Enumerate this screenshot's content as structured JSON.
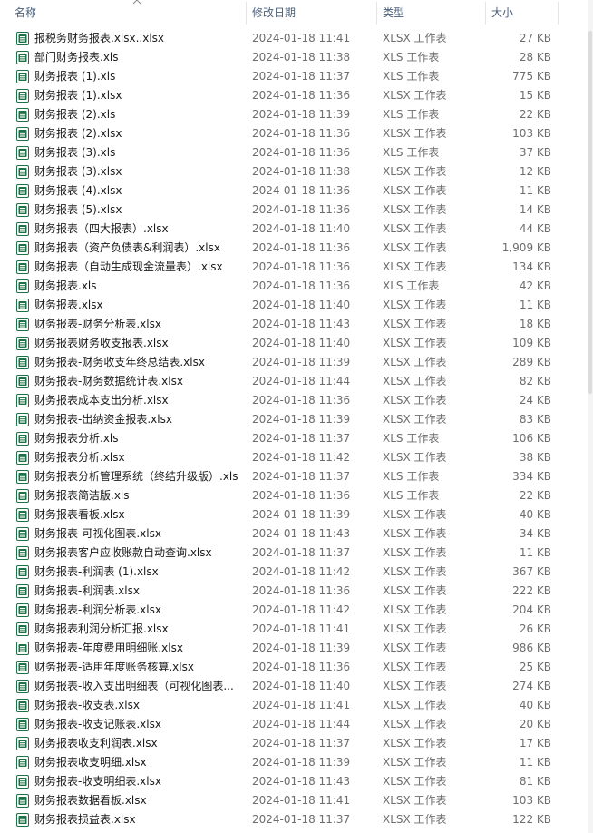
{
  "columns": {
    "name": "名称",
    "date": "修改日期",
    "type": "类型",
    "size": "大小"
  },
  "icons": {
    "sort": "sort-ascending-icon",
    "file": "excel-file-icon"
  },
  "colors": {
    "excel_green": "#1e7145",
    "header_text": "#4c607a",
    "meta_text": "#6d6d6d"
  },
  "files": [
    {
      "name": "报税务财务报表.xlsx..xlsx",
      "date": "2024-01-18 11:41",
      "type": "XLSX 工作表",
      "size": "27 KB"
    },
    {
      "name": "部门财务报表.xls",
      "date": "2024-01-18 11:38",
      "type": "XLS 工作表",
      "size": "28 KB"
    },
    {
      "name": "财务报表 (1).xls",
      "date": "2024-01-18 11:37",
      "type": "XLS 工作表",
      "size": "775 KB"
    },
    {
      "name": "财务报表 (1).xlsx",
      "date": "2024-01-18 11:36",
      "type": "XLSX 工作表",
      "size": "15 KB"
    },
    {
      "name": "财务报表 (2).xls",
      "date": "2024-01-18 11:39",
      "type": "XLS 工作表",
      "size": "22 KB"
    },
    {
      "name": "财务报表 (2).xlsx",
      "date": "2024-01-18 11:36",
      "type": "XLSX 工作表",
      "size": "103 KB"
    },
    {
      "name": "财务报表 (3).xls",
      "date": "2024-01-18 11:36",
      "type": "XLS 工作表",
      "size": "37 KB"
    },
    {
      "name": "财务报表 (3).xlsx",
      "date": "2024-01-18 11:38",
      "type": "XLSX 工作表",
      "size": "12 KB"
    },
    {
      "name": "财务报表 (4).xlsx",
      "date": "2024-01-18 11:36",
      "type": "XLSX 工作表",
      "size": "11 KB"
    },
    {
      "name": "财务报表 (5).xlsx",
      "date": "2024-01-18 11:36",
      "type": "XLSX 工作表",
      "size": "14 KB"
    },
    {
      "name": "财务报表（四大报表）.xlsx",
      "date": "2024-01-18 11:40",
      "type": "XLSX 工作表",
      "size": "44 KB"
    },
    {
      "name": "财务报表（资产负债表&利润表）.xlsx",
      "date": "2024-01-18 11:36",
      "type": "XLSX 工作表",
      "size": "1,909 KB"
    },
    {
      "name": "财务报表（自动生成现金流量表）.xlsx",
      "date": "2024-01-18 11:36",
      "type": "XLSX 工作表",
      "size": "134 KB"
    },
    {
      "name": "财务报表.xls",
      "date": "2024-01-18 11:36",
      "type": "XLS 工作表",
      "size": "42 KB"
    },
    {
      "name": "财务报表.xlsx",
      "date": "2024-01-18 11:40",
      "type": "XLSX 工作表",
      "size": "11 KB"
    },
    {
      "name": "财务报表-财务分析表.xlsx",
      "date": "2024-01-18 11:43",
      "type": "XLSX 工作表",
      "size": "18 KB"
    },
    {
      "name": "财务报表财务收支报表.xlsx",
      "date": "2024-01-18 11:40",
      "type": "XLSX 工作表",
      "size": "109 KB"
    },
    {
      "name": "财务报表-财务收支年终总结表.xlsx",
      "date": "2024-01-18 11:39",
      "type": "XLSX 工作表",
      "size": "289 KB"
    },
    {
      "name": "财务报表-财务数据统计表.xlsx",
      "date": "2024-01-18 11:44",
      "type": "XLSX 工作表",
      "size": "82 KB"
    },
    {
      "name": "财务报表成本支出分析.xlsx",
      "date": "2024-01-18 11:36",
      "type": "XLSX 工作表",
      "size": "24 KB"
    },
    {
      "name": "财务报表-出纳资金报表.xlsx",
      "date": "2024-01-18 11:39",
      "type": "XLSX 工作表",
      "size": "83 KB"
    },
    {
      "name": "财务报表分析.xls",
      "date": "2024-01-18 11:37",
      "type": "XLS 工作表",
      "size": "106 KB"
    },
    {
      "name": "财务报表分析.xlsx",
      "date": "2024-01-18 11:42",
      "type": "XLSX 工作表",
      "size": "38 KB"
    },
    {
      "name": "财务报表分析管理系统（终结升级版）.xls",
      "date": "2024-01-18 11:37",
      "type": "XLS 工作表",
      "size": "334 KB"
    },
    {
      "name": "财务报表简洁版.xls",
      "date": "2024-01-18 11:36",
      "type": "XLS 工作表",
      "size": "22 KB"
    },
    {
      "name": "财务报表看板.xlsx",
      "date": "2024-01-18 11:39",
      "type": "XLSX 工作表",
      "size": "40 KB"
    },
    {
      "name": "财务报表-可视化图表.xlsx",
      "date": "2024-01-18 11:43",
      "type": "XLSX 工作表",
      "size": "34 KB"
    },
    {
      "name": "财务报表客户应收账款自动查询.xlsx",
      "date": "2024-01-18 11:37",
      "type": "XLSX 工作表",
      "size": "11 KB"
    },
    {
      "name": "财务报表-利润表 (1).xlsx",
      "date": "2024-01-18 11:42",
      "type": "XLSX 工作表",
      "size": "367 KB"
    },
    {
      "name": "财务报表-利润表.xlsx",
      "date": "2024-01-18 11:36",
      "type": "XLSX 工作表",
      "size": "222 KB"
    },
    {
      "name": "财务报表-利润分析表.xlsx",
      "date": "2024-01-18 11:42",
      "type": "XLSX 工作表",
      "size": "204 KB"
    },
    {
      "name": "财务报表利润分析汇报.xlsx",
      "date": "2024-01-18 11:41",
      "type": "XLSX 工作表",
      "size": "26 KB"
    },
    {
      "name": "财务报表-年度费用明细账.xlsx",
      "date": "2024-01-18 11:39",
      "type": "XLSX 工作表",
      "size": "986 KB"
    },
    {
      "name": "财务报表-适用年度账务核算.xlsx",
      "date": "2024-01-18 11:36",
      "type": "XLSX 工作表",
      "size": "25 KB"
    },
    {
      "name": "财务报表-收入支出明细表（可视化图表...",
      "date": "2024-01-18 11:40",
      "type": "XLSX 工作表",
      "size": "274 KB"
    },
    {
      "name": "财务报表-收支表.xlsx",
      "date": "2024-01-18 11:41",
      "type": "XLSX 工作表",
      "size": "40 KB"
    },
    {
      "name": "财务报表-收支记账表.xlsx",
      "date": "2024-01-18 11:44",
      "type": "XLSX 工作表",
      "size": "20 KB"
    },
    {
      "name": "财务报表收支利润表.xlsx",
      "date": "2024-01-18 11:37",
      "type": "XLSX 工作表",
      "size": "17 KB"
    },
    {
      "name": "财务报表收支明细.xlsx",
      "date": "2024-01-18 11:39",
      "type": "XLSX 工作表",
      "size": "11 KB"
    },
    {
      "name": "财务报表-收支明细表.xlsx",
      "date": "2024-01-18 11:43",
      "type": "XLSX 工作表",
      "size": "81 KB"
    },
    {
      "name": "财务报表数据看板.xlsx",
      "date": "2024-01-18 11:41",
      "type": "XLSX 工作表",
      "size": "103 KB"
    },
    {
      "name": "财务报表损益表.xlsx",
      "date": "2024-01-18 11:37",
      "type": "XLSX 工作表",
      "size": "122 KB"
    }
  ]
}
